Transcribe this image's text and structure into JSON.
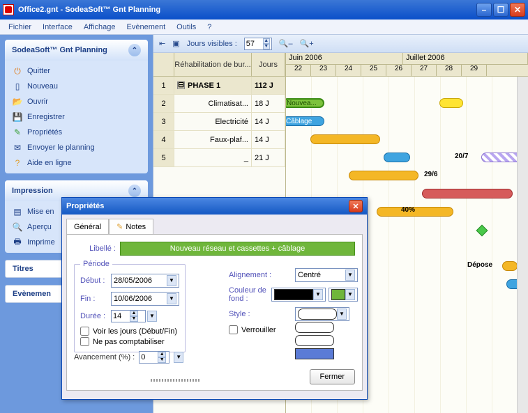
{
  "window": {
    "title": "Office2.gnt - SodeaSoft™ Gnt Planning"
  },
  "menu": {
    "fichier": "Fichier",
    "interface": "Interface",
    "affichage": "Affichage",
    "evenement": "Evènement",
    "outils": "Outils",
    "help": "?"
  },
  "toolbar": {
    "joursvisibles": "Jours visibles :",
    "value": "57"
  },
  "sidebar": {
    "panel1_title": "SodeaSoft™ Gnt Planning",
    "items1": {
      "quitter": "Quitter",
      "nouveau": "Nouveau",
      "ouvrir": "Ouvrir",
      "enreg": "Enregistrer",
      "prop": "Propriétés",
      "envoyer": "Envoyer le planning",
      "aide": "Aide en ligne"
    },
    "panel2_title": "Impression",
    "items2": {
      "mise": "Mise en",
      "apercu": "Aperçu",
      "imprimer": "Imprime"
    },
    "titres": "Titres",
    "evenement": "Evènemen"
  },
  "grid": {
    "header": {
      "name": "Réhabilitation de bur...",
      "jours": "Jours"
    },
    "rows": [
      {
        "n": "1",
        "name": "PHASE 1",
        "dur": "112 J",
        "bold": true,
        "collapse": "⊟"
      },
      {
        "n": "2",
        "name": "Climatisat...",
        "dur": "18 J"
      },
      {
        "n": "3",
        "name": "Electricité",
        "dur": "14 J"
      },
      {
        "n": "4",
        "name": "Faux-plaf...",
        "dur": "14 J"
      },
      {
        "n": "5",
        "name": "_",
        "dur": "21 J"
      }
    ],
    "months": {
      "juin": "Juin 2006",
      "juil": "Juillet 2006"
    },
    "days": [
      "22",
      "23",
      "24",
      "25",
      "26",
      "27",
      "28",
      "29"
    ],
    "labels": {
      "nouvea": "Nouvea...",
      "cablage": "Câblage",
      "d296": "29/6",
      "d207": "20/7",
      "p40": "40%",
      "depose": "Dépose"
    }
  },
  "dialog": {
    "title": "Propriétés",
    "tabs": {
      "general": "Général",
      "notes": "Notes"
    },
    "libelle": "Libellé :",
    "libelle_val": "Nouveau réseau et cassettes + câblage",
    "periode": "Période",
    "debut": "Début :",
    "fin": "Fin :",
    "duree": "Durée :",
    "debut_v": "28/05/2006",
    "fin_v": "10/06/2006",
    "duree_v": "14",
    "voir": "Voir les jours (Début/Fin)",
    "nepas": "Ne pas comptabiliser",
    "align": "Alignement :",
    "align_v": "Centré",
    "couleur": "Couleur de fond :",
    "style": "Style :",
    "verrou": "Verrouiller",
    "avance": "Avancement (%) :",
    "avance_v": "0",
    "fermer": "Fermer"
  }
}
